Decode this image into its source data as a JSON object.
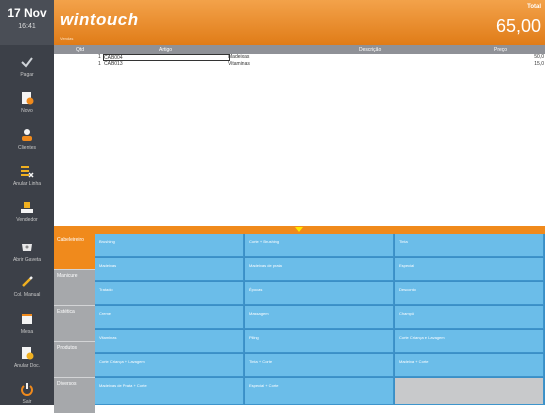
{
  "date": {
    "day": "17 Nov",
    "time": "16:41"
  },
  "header": {
    "logo": "wintouch",
    "logo_sub": "Vendas",
    "total_label": "Total",
    "total_value": "65,00"
  },
  "sidebar": {
    "items": [
      {
        "label": "Pagar",
        "icon": "check-icon"
      },
      {
        "label": "Novo",
        "icon": "new-doc-icon"
      },
      {
        "label": "Clientes",
        "icon": "clients-icon"
      },
      {
        "label": "Anular Linha",
        "icon": "cancel-line-icon"
      },
      {
        "label": "Vendedor",
        "icon": "seller-icon"
      },
      {
        "label": "Abrir Gaveta",
        "icon": "drawer-icon"
      },
      {
        "label": "Col. Manual",
        "icon": "edit-icon"
      },
      {
        "label": "Mesa",
        "icon": "table-icon"
      },
      {
        "label": "Anular Doc.",
        "icon": "cancel-doc-icon"
      },
      {
        "label": "Sair",
        "icon": "power-icon"
      }
    ]
  },
  "table": {
    "headers": {
      "qtd": "Qtd",
      "artigo": "Artigo",
      "descricao": "Descrição",
      "preco": "Preço"
    },
    "rows": [
      {
        "qtd": "1",
        "artigo": "CAB004",
        "descricao": "Madeixas",
        "preco": "50,0"
      },
      {
        "qtd": "1",
        "artigo": "CAB013",
        "descricao": "Vitaminas",
        "preco": "15,0"
      }
    ]
  },
  "categories": [
    {
      "label": "Cabeleireiro",
      "active": true
    },
    {
      "label": "Manicure",
      "active": false
    },
    {
      "label": "Estética",
      "active": false
    },
    {
      "label": "Produtos",
      "active": false
    },
    {
      "label": "Diversos",
      "active": false
    }
  ],
  "products": [
    [
      "Brushing",
      "Corte + Brushing",
      "Tinta"
    ],
    [
      "Madeixas",
      "Madeixas de prata",
      "Especial"
    ],
    [
      "Tratado",
      "Épocas",
      "Desconto"
    ],
    [
      "Creme",
      "Massagem",
      "Champô"
    ],
    [
      "Vitaminas",
      "Piling",
      "Corte Criança e Lavagem"
    ],
    [
      "Corte Criança + Lavagem",
      "Tinta + Corte",
      "Madeixa + Corte"
    ],
    [
      "Madeixas de Prata + Corte",
      "Especial + Corte",
      ""
    ]
  ]
}
